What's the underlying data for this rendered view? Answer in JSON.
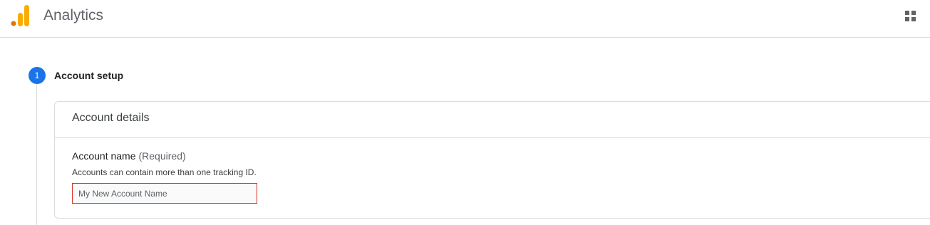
{
  "app": {
    "title": "Analytics",
    "logo_icon": "google-analytics-logo",
    "apps_icon": "apps-grid-icon",
    "colors": {
      "logo_orange": "#f9ab00",
      "logo_dark_orange": "#e37400",
      "accent": "#1a73e8",
      "error": "#d93025"
    }
  },
  "stepper": {
    "step_number": "1",
    "step_title": "Account setup"
  },
  "account_details": {
    "card_title": "Account details",
    "field_label": "Account name",
    "field_required": "(Required)",
    "field_hint": "Accounts can contain more than one tracking ID.",
    "input_value": "",
    "input_placeholder": "My New Account Name"
  }
}
